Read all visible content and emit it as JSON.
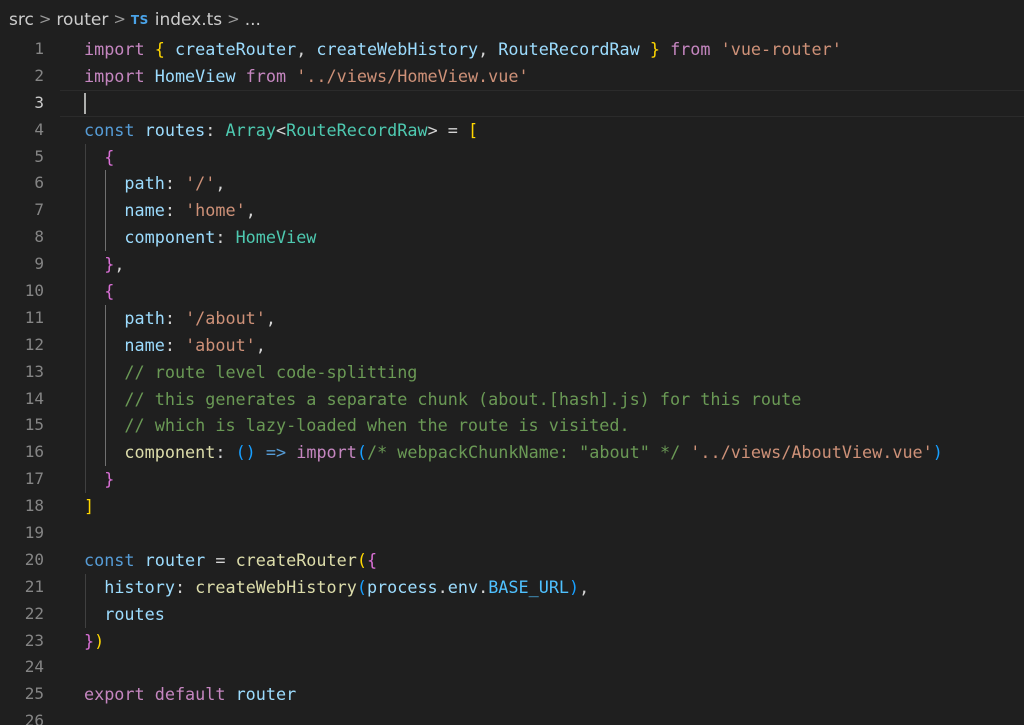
{
  "breadcrumb": {
    "items": [
      "src",
      "router",
      "index.ts",
      "..."
    ],
    "file_icon_text": "TS",
    "separator": ">"
  },
  "editor": {
    "current_line": 3,
    "line_numbers": [
      "1",
      "2",
      "3",
      "4",
      "5",
      "6",
      "7",
      "8",
      "9",
      "10",
      "11",
      "12",
      "13",
      "14",
      "15",
      "16",
      "17",
      "18",
      "19",
      "20",
      "21",
      "22",
      "23",
      "24",
      "25",
      "26"
    ],
    "lines": [
      [
        [
          "kw",
          "import"
        ],
        [
          "p",
          " "
        ],
        [
          "b1",
          "{"
        ],
        [
          "p",
          " "
        ],
        [
          "va",
          "createRouter"
        ],
        [
          "p",
          ", "
        ],
        [
          "va",
          "createWebHistory"
        ],
        [
          "p",
          ", "
        ],
        [
          "va",
          "RouteRecordRaw"
        ],
        [
          "p",
          " "
        ],
        [
          "b1",
          "}"
        ],
        [
          "p",
          " "
        ],
        [
          "kw",
          "from"
        ],
        [
          "p",
          " "
        ],
        [
          "str",
          "'vue-router'"
        ]
      ],
      [
        [
          "kw",
          "import"
        ],
        [
          "p",
          " "
        ],
        [
          "va",
          "HomeView"
        ],
        [
          "p",
          " "
        ],
        [
          "kw",
          "from"
        ],
        [
          "p",
          " "
        ],
        [
          "str",
          "'../views/HomeView.vue'"
        ]
      ],
      [],
      [
        [
          "st",
          "const"
        ],
        [
          "p",
          " "
        ],
        [
          "va",
          "routes"
        ],
        [
          "p",
          ": "
        ],
        [
          "ty",
          "Array"
        ],
        [
          "p",
          "<"
        ],
        [
          "ty",
          "RouteRecordRaw"
        ],
        [
          "p",
          "> = "
        ],
        [
          "b1",
          "["
        ]
      ],
      [
        [
          "p",
          "  "
        ],
        [
          "b2",
          "{"
        ]
      ],
      [
        [
          "p",
          "    "
        ],
        [
          "va",
          "path"
        ],
        [
          "p",
          ": "
        ],
        [
          "str",
          "'/'"
        ],
        [
          "p",
          ","
        ]
      ],
      [
        [
          "p",
          "    "
        ],
        [
          "va",
          "name"
        ],
        [
          "p",
          ": "
        ],
        [
          "str",
          "'home'"
        ],
        [
          "p",
          ","
        ]
      ],
      [
        [
          "p",
          "    "
        ],
        [
          "va",
          "component"
        ],
        [
          "p",
          ": "
        ],
        [
          "ty",
          "HomeView"
        ]
      ],
      [
        [
          "p",
          "  "
        ],
        [
          "b2",
          "}"
        ],
        [
          "p",
          ","
        ]
      ],
      [
        [
          "p",
          "  "
        ],
        [
          "b2",
          "{"
        ]
      ],
      [
        [
          "p",
          "    "
        ],
        [
          "va",
          "path"
        ],
        [
          "p",
          ": "
        ],
        [
          "str",
          "'/about'"
        ],
        [
          "p",
          ","
        ]
      ],
      [
        [
          "p",
          "    "
        ],
        [
          "va",
          "name"
        ],
        [
          "p",
          ": "
        ],
        [
          "str",
          "'about'"
        ],
        [
          "p",
          ","
        ]
      ],
      [
        [
          "p",
          "    "
        ],
        [
          "cm",
          "// route level code-splitting"
        ]
      ],
      [
        [
          "p",
          "    "
        ],
        [
          "cm",
          "// this generates a separate chunk (about.[hash].js) for this route"
        ]
      ],
      [
        [
          "p",
          "    "
        ],
        [
          "cm",
          "// which is lazy-loaded when the route is visited."
        ]
      ],
      [
        [
          "p",
          "    "
        ],
        [
          "fn",
          "component"
        ],
        [
          "p",
          ": "
        ],
        [
          "b3",
          "()"
        ],
        [
          "p",
          " "
        ],
        [
          "st",
          "=>"
        ],
        [
          "p",
          " "
        ],
        [
          "kw",
          "import"
        ],
        [
          "b3",
          "("
        ],
        [
          "cm",
          "/* webpackChunkName: \"about\" */"
        ],
        [
          "p",
          " "
        ],
        [
          "str",
          "'../views/AboutView.vue'"
        ],
        [
          "b3",
          ")"
        ]
      ],
      [
        [
          "p",
          "  "
        ],
        [
          "b2",
          "}"
        ]
      ],
      [
        [
          "b1",
          "]"
        ]
      ],
      [],
      [
        [
          "st",
          "const"
        ],
        [
          "p",
          " "
        ],
        [
          "va",
          "router"
        ],
        [
          "p",
          " = "
        ],
        [
          "fn",
          "createRouter"
        ],
        [
          "b1",
          "("
        ],
        [
          "b2",
          "{"
        ]
      ],
      [
        [
          "p",
          "  "
        ],
        [
          "va",
          "history"
        ],
        [
          "p",
          ": "
        ],
        [
          "fn",
          "createWebHistory"
        ],
        [
          "b3",
          "("
        ],
        [
          "va",
          "process"
        ],
        [
          "p",
          "."
        ],
        [
          "va",
          "env"
        ],
        [
          "p",
          "."
        ],
        [
          "co",
          "BASE_URL"
        ],
        [
          "b3",
          ")"
        ],
        [
          "p",
          ","
        ]
      ],
      [
        [
          "p",
          "  "
        ],
        [
          "va",
          "routes"
        ]
      ],
      [
        [
          "b2",
          "}"
        ],
        [
          "b1",
          ")"
        ]
      ],
      [],
      [
        [
          "kw",
          "export"
        ],
        [
          "p",
          " "
        ],
        [
          "kw",
          "default"
        ],
        [
          "p",
          " "
        ],
        [
          "va",
          "router"
        ]
      ],
      []
    ]
  }
}
